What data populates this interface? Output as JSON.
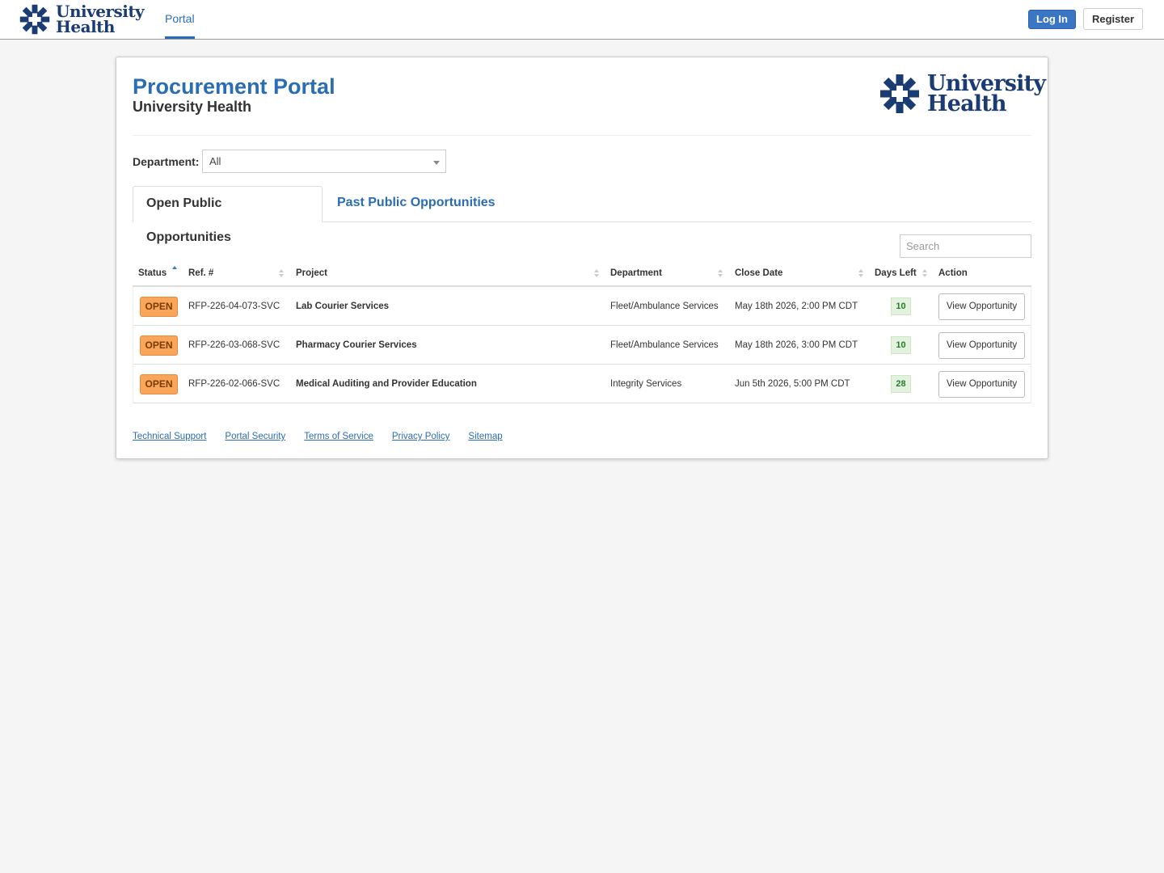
{
  "brand": {
    "line1": "University",
    "line2": "Health",
    "color": "#1b3b73"
  },
  "nav": {
    "portal_label": "Portal",
    "login_label": "Log In",
    "register_label": "Register"
  },
  "page": {
    "title": "Procurement Portal",
    "subtitle": "University Health"
  },
  "filter": {
    "department_label": "Department:",
    "department_value": "All"
  },
  "tabs": [
    {
      "label": "Open Public Opportunities",
      "active": true
    },
    {
      "label": "Past Public Opportunities",
      "active": false
    }
  ],
  "search": {
    "placeholder": "Search"
  },
  "table": {
    "columns": [
      "Status",
      "Ref. #",
      "Project",
      "Department",
      "Close Date",
      "Days Left",
      "Action"
    ],
    "rows": [
      {
        "status": "OPEN",
        "ref": "RFP-226-04-073-SVC",
        "project": "Lab Courier Services",
        "department": "Fleet/Ambulance Services",
        "close_date": "May 18th 2026, 2:00 PM CDT",
        "days_left": "10",
        "action": "View Opportunity"
      },
      {
        "status": "OPEN",
        "ref": "RFP-226-03-068-SVC",
        "project": "Pharmacy Courier Services",
        "department": "Fleet/Ambulance Services",
        "close_date": "May 18th 2026, 3:00 PM CDT",
        "days_left": "10",
        "action": "View Opportunity"
      },
      {
        "status": "OPEN",
        "ref": "RFP-226-02-066-SVC",
        "project": "Medical Auditing and Provider Education",
        "department": "Integrity Services",
        "close_date": "Jun 5th 2026, 5:00 PM CDT",
        "days_left": "28",
        "action": "View Opportunity"
      }
    ]
  },
  "footer": {
    "links": [
      "Technical Support",
      "Portal Security",
      "Terms of Service",
      "Privacy Policy",
      "Sitemap"
    ]
  },
  "colors": {
    "accent": "#2a6db5",
    "login_button": "#3a76c4",
    "status_open": "#f9a55a",
    "days_left_bg": "#e2f2df"
  }
}
